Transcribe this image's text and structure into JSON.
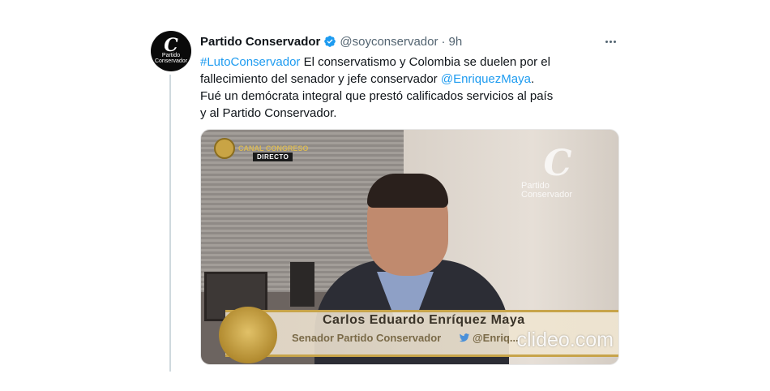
{
  "tweet": {
    "author_name": "Partido Conservador",
    "handle": "@soyconservador",
    "separator": "·",
    "time": "9h",
    "avatar": {
      "glyph": "C",
      "line1": "Partido",
      "line2": "Conservador"
    },
    "text": {
      "hashtag": "#LutoConservador",
      "part1": " El conservatismo y Colombia se duelen por el fallecimiento del senador y jefe conservador ",
      "mention": "@EnriquezMaya",
      "part2": ". Fué un demócrata integral que prestó calificados servicios al país y al Partido Conservador."
    },
    "more_icon": "more-horizontal-icon",
    "verified_icon": "verified-badge-icon",
    "colors": {
      "link": "#1d9bf0",
      "verified": "#1d9bf0",
      "muted": "#536471"
    }
  },
  "media": {
    "logo_text": "CANAL CONGRESO",
    "directo": "DIRECTO",
    "watermark": {
      "glyph": "C",
      "text": "Partido Conservador"
    },
    "lower_third": {
      "name": "Carlos Eduardo Enríquez Maya",
      "role": "Senador Partido Conservador",
      "handle": "@Enriq..."
    },
    "clideo": "clideo.com"
  }
}
